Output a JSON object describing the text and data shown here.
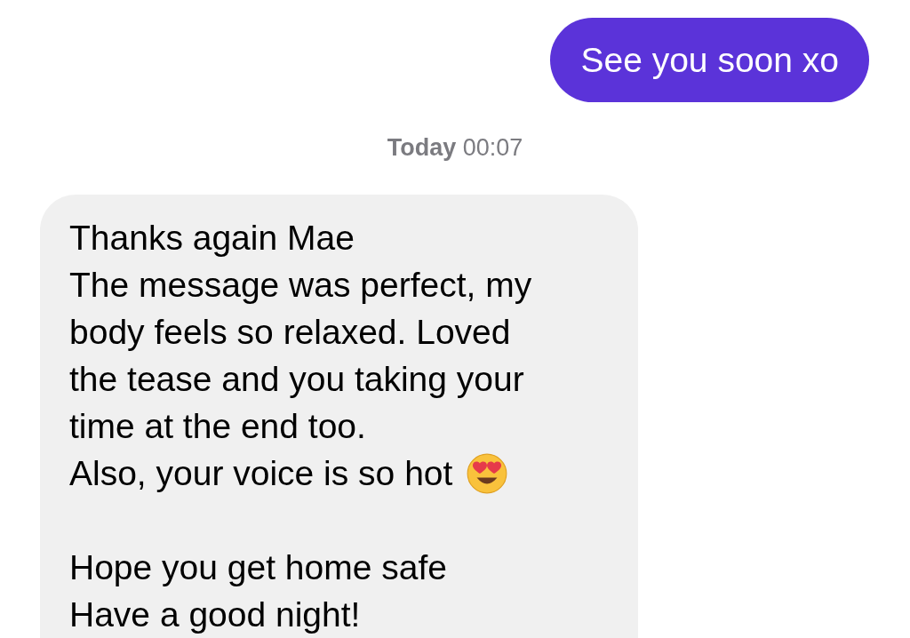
{
  "messages": [
    {
      "kind": "sent",
      "paragraphs": [
        [
          "See you soon xo"
        ]
      ]
    },
    {
      "kind": "timestamp",
      "day": "Today",
      "time": "00:07"
    },
    {
      "kind": "received",
      "paragraphs": [
        [
          "Thanks again Mae",
          "The message was perfect, my body feels so relaxed. Loved the tease and you taking your time at the end too.",
          "Also, your voice is so hot"
        ],
        [
          "Hope you get home safe",
          "Have a good night!"
        ]
      ],
      "emoji_after": true
    }
  ]
}
